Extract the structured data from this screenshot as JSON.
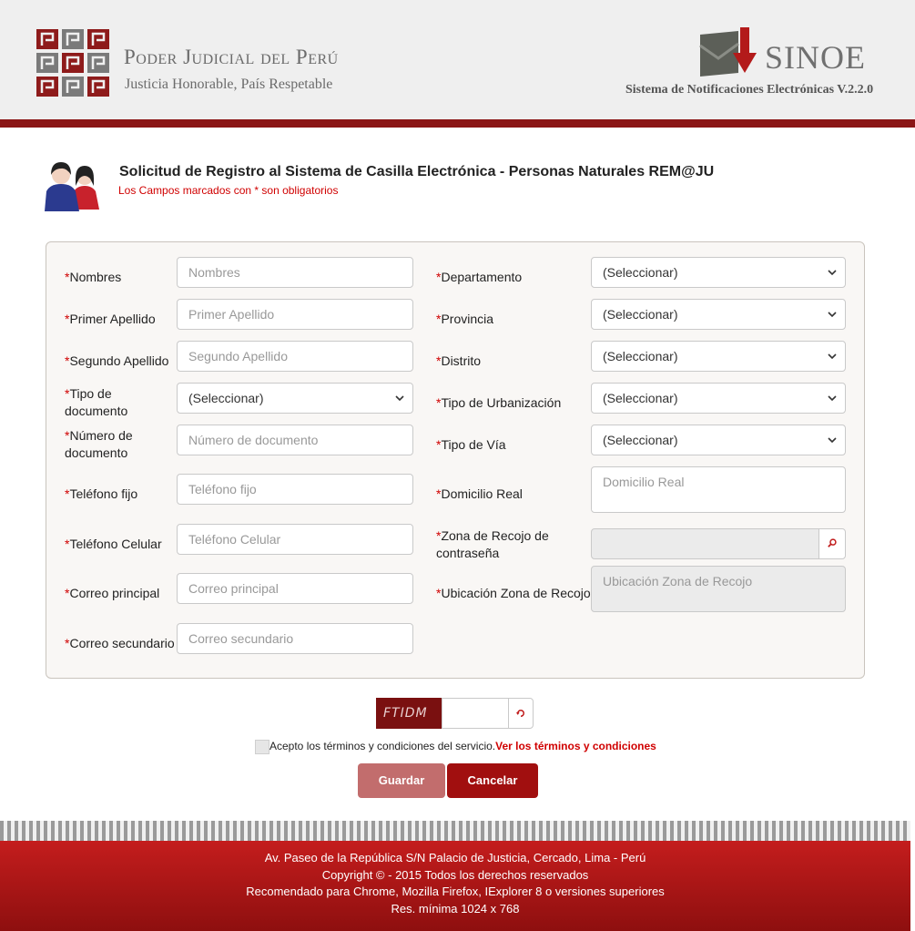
{
  "header": {
    "institution": "Poder Judicial del Perú",
    "motto": "Justicia Honorable, País Respetable",
    "system_name": "SINOE",
    "system_subtitle": "Sistema de Notificaciones Electrónicas V.2.2.0"
  },
  "page": {
    "title": "Solicitud de Registro al Sistema de Casilla Electrónica - Personas Naturales REM@JU",
    "required_note": "Los Campos marcados con * son obligatorios"
  },
  "form": {
    "required_mark": "*",
    "left": {
      "nombres": {
        "label": "Nombres",
        "placeholder": "Nombres"
      },
      "primer_apellido": {
        "label": "Primer Apellido",
        "placeholder": "Primer Apellido"
      },
      "segundo_apellido": {
        "label": "Segundo Apellido",
        "placeholder": "Segundo Apellido"
      },
      "tipo_documento": {
        "label_line1": "Tipo de",
        "label_line2": "documento",
        "value": "(Seleccionar)"
      },
      "numero_documento": {
        "label_line1": "Número de",
        "label_line2": "documento",
        "placeholder": "Número de documento"
      },
      "telefono_fijo": {
        "label": "Teléfono fijo",
        "placeholder": "Teléfono fijo"
      },
      "telefono_celular": {
        "label": "Teléfono Celular",
        "placeholder": "Teléfono Celular"
      },
      "correo_principal": {
        "label": "Correo principal",
        "placeholder": "Correo principal"
      },
      "correo_secundario": {
        "label": "Correo secundario",
        "placeholder": "Correo secundario"
      }
    },
    "right": {
      "departamento": {
        "label": "Departamento",
        "value": "(Seleccionar)"
      },
      "provincia": {
        "label": "Provincia",
        "value": "(Seleccionar)"
      },
      "distrito": {
        "label": "Distrito",
        "value": "(Seleccionar)"
      },
      "tipo_urbanizacion": {
        "label": "Tipo de Urbanización",
        "value": "(Seleccionar)"
      },
      "tipo_via": {
        "label": "Tipo de Vía",
        "value": "(Seleccionar)"
      },
      "domicilio_real": {
        "label": "Domicilio Real",
        "placeholder": "Domicilio Real"
      },
      "zona_recojo": {
        "label_line1": "Zona de Recojo de",
        "label_line2": "contraseña",
        "value": ""
      },
      "ubicacion_zona": {
        "label": "Ubicación Zona de Recojo",
        "placeholder": "Ubicación Zona de Recojo"
      }
    }
  },
  "captcha": {
    "text": "FTIDM",
    "value": ""
  },
  "terms": {
    "text": "Acepto los términos y condiciones del servicio.",
    "link": "Ver los términos y condiciones",
    "checked": false
  },
  "buttons": {
    "save": "Guardar",
    "cancel": "Cancelar"
  },
  "footer": {
    "line1": "Av. Paseo de la República S/N Palacio de Justicia, Cercado, Lima - Perú",
    "line2": "Copyright © - 2015 Todos los derechos reservados",
    "line3": "Recomendado para Chrome, Mozilla Firefox, IExplorer 8 o versiones superiores",
    "line4": "Res. mínima 1024 x 768"
  },
  "colors": {
    "brand_red": "#8b1616",
    "required_red": "#d00000",
    "save_button": "#c26d6d",
    "cancel_button": "#a10f0f"
  },
  "icons": [
    "pj-logo-icon",
    "sinoe-mail-icon",
    "users-icon",
    "chevron-down-icon",
    "search-icon",
    "refresh-icon"
  ]
}
